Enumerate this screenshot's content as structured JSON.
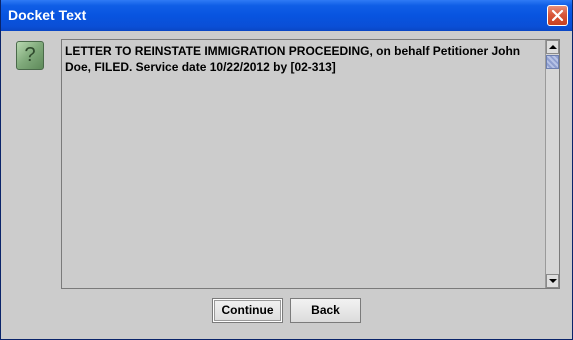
{
  "window": {
    "title": "Docket Text",
    "close_icon": "close-icon"
  },
  "dialog": {
    "icon": "question-icon",
    "icon_glyph": "?",
    "text": "LETTER TO REINSTATE IMMIGRATION PROCEEDING, on behalf Petitioner John Doe, FILED. Service date 10/22/2012 by [02-313]"
  },
  "buttons": {
    "continue_label": "Continue",
    "back_label": "Back"
  },
  "colors": {
    "titlebar": "#0854e0",
    "dialog_background": "#cccccc",
    "close_button": "#d9573a",
    "scroll_thumb": "#b7c3e6"
  }
}
